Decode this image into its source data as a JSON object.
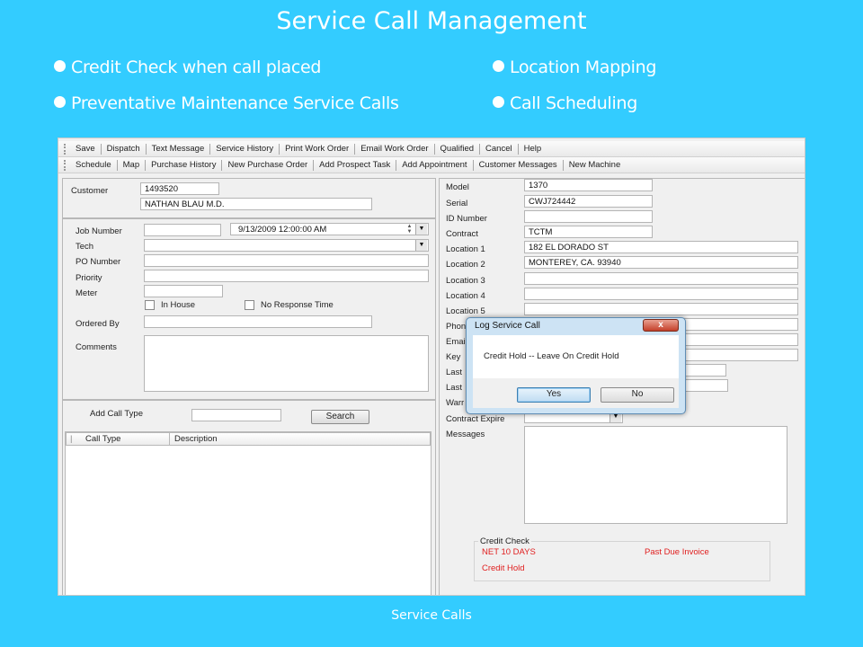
{
  "slide": {
    "title": "Service Call Management",
    "bullets": [
      "Credit Check when call placed",
      "Preventative Maintenance Service Calls",
      "Location Mapping",
      "Call Scheduling"
    ],
    "footer": "Service Calls"
  },
  "toolbar1": [
    "Save",
    "Dispatch",
    "Text Message",
    "Service History",
    "Print Work Order",
    "Email Work Order",
    "Qualified",
    "Cancel",
    "Help"
  ],
  "toolbar2": [
    "Schedule",
    "Map",
    "Purchase History",
    "New Purchase Order",
    "Add Prospect Task",
    "Add Appointment",
    "Customer Messages",
    "New Machine"
  ],
  "customer": {
    "label": "Customer",
    "number": "1493520",
    "name": "NATHAN BLAU M.D."
  },
  "job": {
    "job_number_label": "Job Number",
    "job_number": "",
    "datetime": "9/13/2009 12:00:00 AM",
    "tech_label": "Tech",
    "po_label": "PO Number",
    "priority_label": "Priority",
    "meter_label": "Meter",
    "in_house_label": "In House",
    "no_response_label": "No Response Time",
    "ordered_by_label": "Ordered By",
    "comments_label": "Comments"
  },
  "call_type": {
    "add_label": "Add Call Type",
    "search_button": "Search",
    "columns": [
      "Call Type",
      "Description"
    ]
  },
  "machine": {
    "model_label": "Model",
    "model": "1370",
    "serial_label": "Serial",
    "serial": "CWJ724442",
    "id_label": "ID Number",
    "contract_label": "Contract",
    "contract": "TCTM",
    "location1_label": "Location 1",
    "location1": "182 EL DORADO ST",
    "location2_label": "Location 2",
    "location2": "MONTEREY, CA. 93940",
    "location3_label": "Location 3",
    "location4_label": "Location 4",
    "location5_label": "Location 5",
    "phone_label": "Phon",
    "email_label": "Emai",
    "key_label": "Key",
    "last1_label": "Last",
    "last2_label": "Last",
    "warranty_label": "Warr",
    "contract_expire_label": "Contract Expire",
    "messages_label": "Messages"
  },
  "credit_check": {
    "title": "Credit Check",
    "terms": "NET 10 DAYS",
    "past_due": "Past Due Invoice",
    "hold": "Credit Hold",
    "alert_color": "#e02020"
  },
  "dialog": {
    "title": "Log Service Call",
    "message": "Credit Hold -- Leave On Credit Hold",
    "yes": "Yes",
    "no": "No",
    "close": "x"
  }
}
